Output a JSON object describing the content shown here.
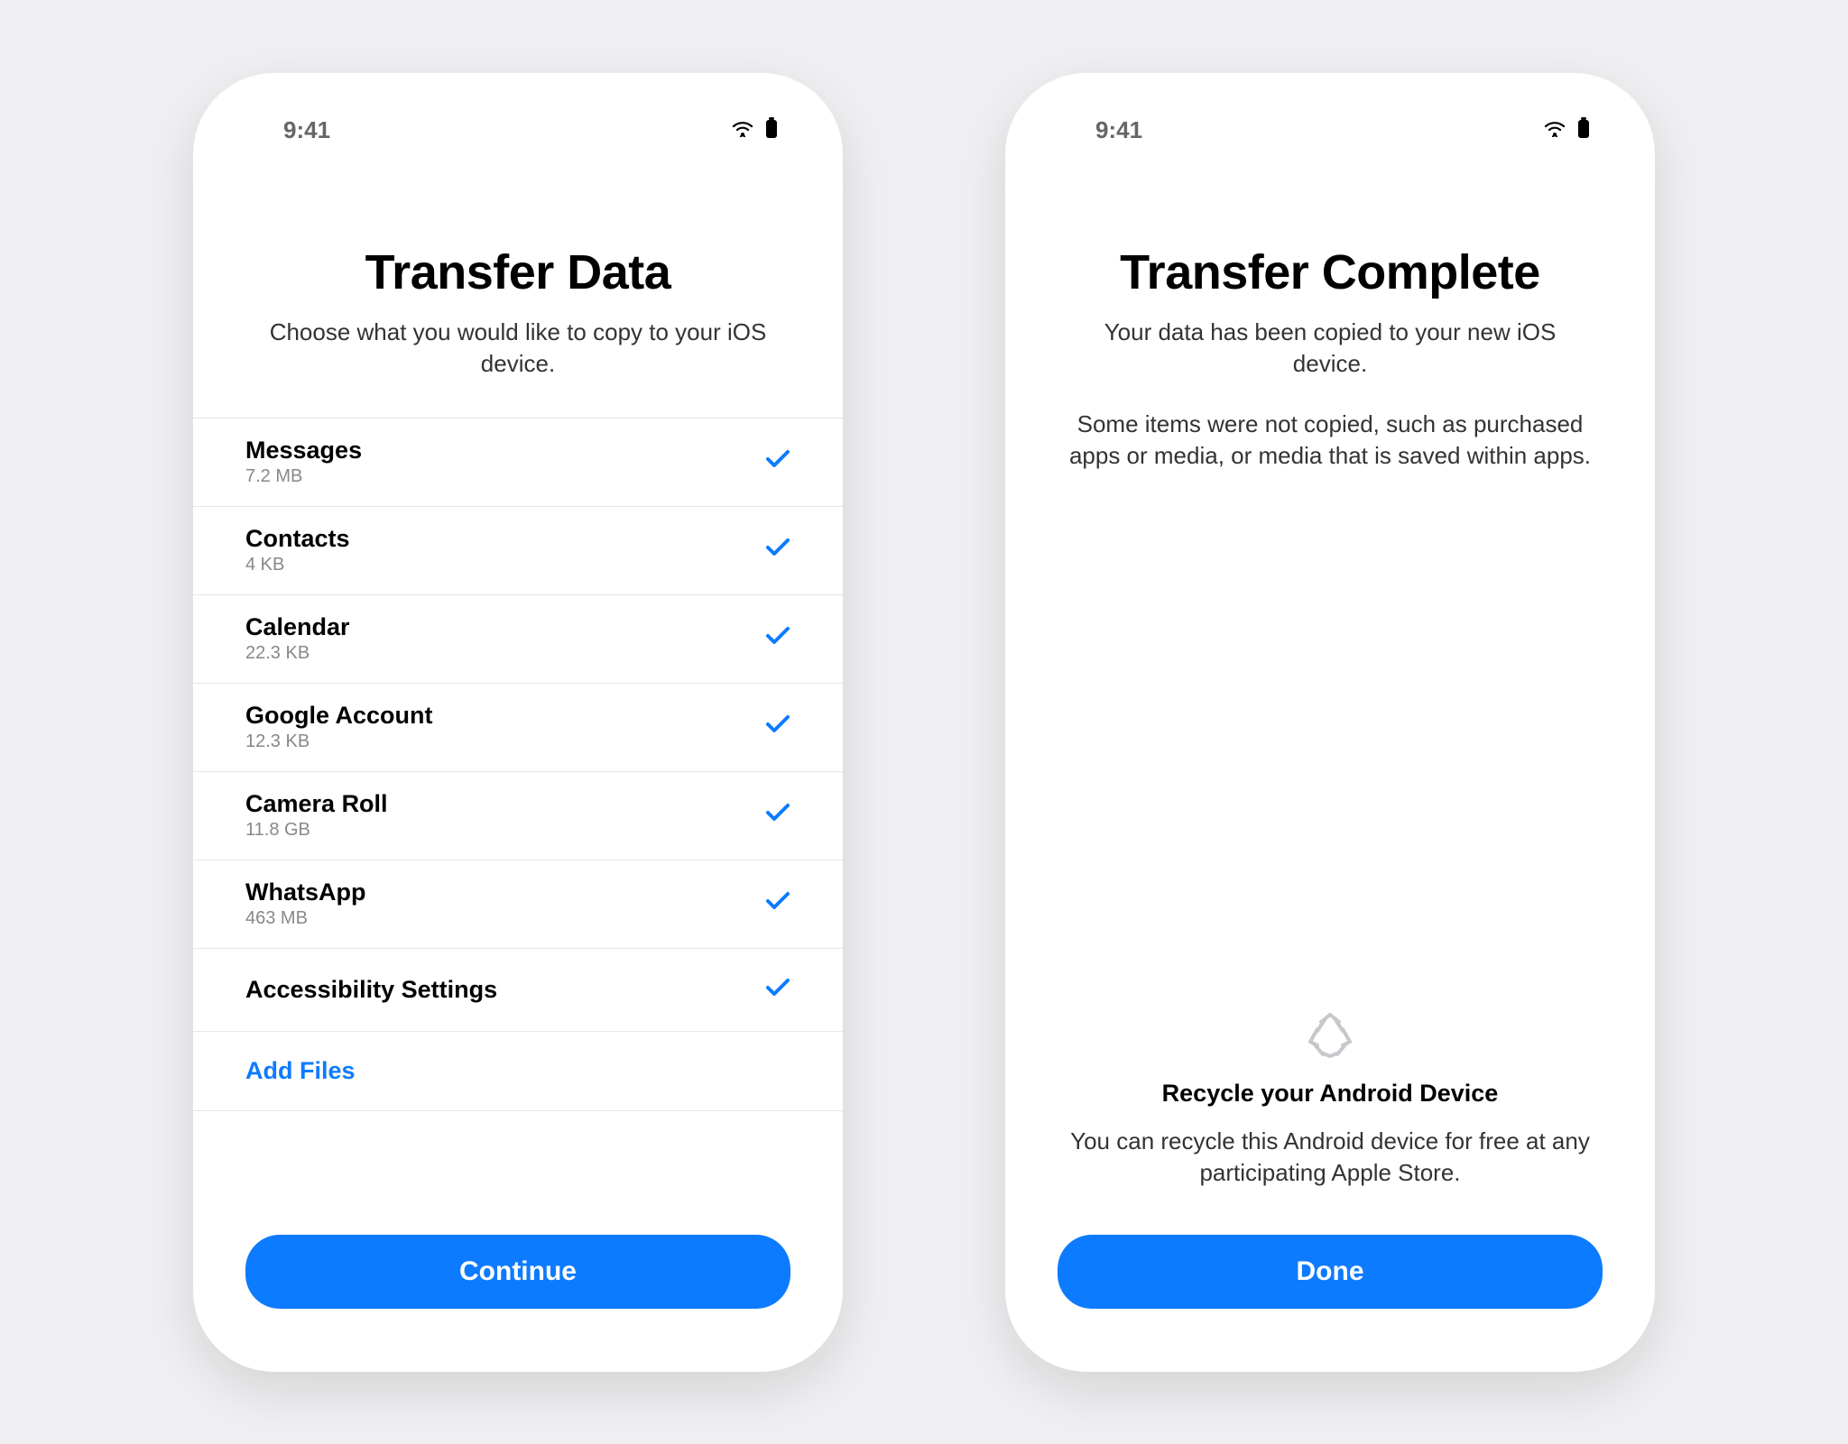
{
  "status": {
    "time": "9:41"
  },
  "screen1": {
    "title": "Transfer Data",
    "subtitle": "Choose what you would like to copy to your iOS device.",
    "items": [
      {
        "label": "Messages",
        "size": "7.2 MB"
      },
      {
        "label": "Contacts",
        "size": "4 KB"
      },
      {
        "label": "Calendar",
        "size": "22.3 KB"
      },
      {
        "label": "Google Account",
        "size": "12.3 KB"
      },
      {
        "label": "Camera Roll",
        "size": "11.8 GB"
      },
      {
        "label": "WhatsApp",
        "size": "463 MB"
      },
      {
        "label": "Accessibility Settings",
        "size": ""
      }
    ],
    "add_files": "Add Files",
    "continue": "Continue"
  },
  "screen2": {
    "title": "Transfer Complete",
    "subtitle": "Your data has been copied to your new iOS device.",
    "subtitle2": "Some items were not copied, such as purchased apps or media, or media that is saved within apps.",
    "recycle_title": "Recycle your Android Device",
    "recycle_text": "You can recycle this Android device for free at any participating Apple Store.",
    "done": "Done"
  }
}
